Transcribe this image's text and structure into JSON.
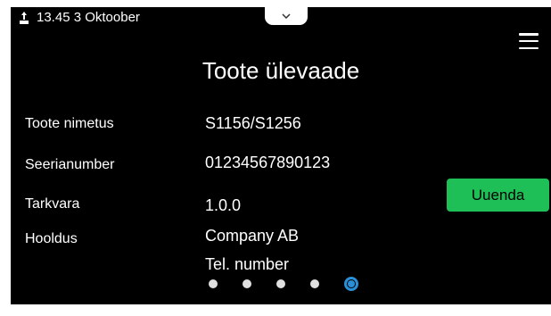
{
  "status": {
    "icon": "usb-icon",
    "datetime": "13.45 3 Oktoober"
  },
  "header": {
    "title": "Toote ülevaade",
    "menu_icon": "hamburger-menu-icon",
    "pull_tab_icon": "chevron-down-icon"
  },
  "info": {
    "product_name_label": "Toote nimetus",
    "product_name_value": "S1156/S1256",
    "serial_label": "Seerianumber",
    "serial_value": "01234567890123",
    "software_label": "Tarkvara",
    "software_value": "1.0.0",
    "service_label": "Hooldus",
    "service_company": "Company AB",
    "service_phone": "Tel. number"
  },
  "actions": {
    "update_label": "Uuenda"
  },
  "pagination": {
    "total_pages": 5,
    "active_page": 5
  },
  "colors": {
    "screen_bg": "#000000",
    "text": "#ffffff",
    "update_button": "#1fbf57",
    "active_dot": "#2a8fd6"
  }
}
